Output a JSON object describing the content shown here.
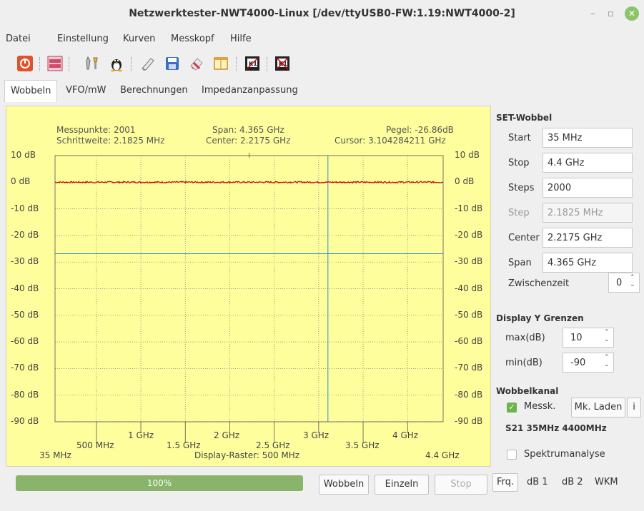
{
  "window": {
    "title": "Netzwerktester-NWT4000-Linux [/dev/ttyUSB0-FW:1.19:NWT4000-2]"
  },
  "menu": [
    "Datei",
    "Einstellung",
    "Kurven",
    "Messkopf",
    "Hilfe"
  ],
  "toolbar": [
    "power-icon",
    "png-bmp-icon",
    "tools-icon",
    "linux-icon",
    "open-icon",
    "save-icon",
    "eraser-icon",
    "window-icon",
    "k1-icon",
    "k1x-icon"
  ],
  "tabs": [
    "Wobbeln",
    "VFO/mW",
    "Berechnungen",
    "Impedanzanpassung"
  ],
  "plot": {
    "messpunkte": "Messpunkte: 2001",
    "schrittweite": "Schrittweite: 2.1825 MHz",
    "span": "Span: 4.365 GHz",
    "center": "Center: 2.2175 GHz",
    "pegel": "Pegel: -26.86dB",
    "cursor": "Cursor: 3.104284211 GHz",
    "raster": "Display-Raster: 500 MHz",
    "y_labels": [
      "10 dB",
      "0 dB",
      "-10 dB",
      "-20 dB",
      "-30 dB",
      "-40 dB",
      "-50 dB",
      "-60 dB",
      "-70 dB",
      "-80 dB",
      "-90 dB"
    ],
    "x_upper": [
      "1 GHz",
      "2 GHz",
      "3 GHz",
      "4 GHz"
    ],
    "x_lower": [
      "500 MHz",
      "1.5 GHz",
      "2.5 GHz",
      "3.5 GHz"
    ],
    "x_start": "35 MHz",
    "x_end": "4.4 GHz"
  },
  "chart_data": {
    "type": "line",
    "x_range_ghz": [
      0.035,
      4.4
    ],
    "ylim": [
      -90,
      10
    ],
    "grid": true,
    "series": [
      {
        "values_db_approx": 0
      }
    ],
    "cursor_ghz": 3.104284211,
    "marker_level_db": -26.86,
    "colors": {
      "trace": "#cc0000",
      "cursor": "#2a8ec8",
      "background": "#fefe9c"
    }
  },
  "set_wobbel": {
    "title": "SET-Wobbel",
    "start_label": "Start",
    "start_value": "35 MHz",
    "stop_label": "Stop",
    "stop_value": "4.4 GHz",
    "steps_label": "Steps",
    "steps_value": "2000",
    "step_label": "Step",
    "step_value": "2.1825 MHz",
    "center_label": "Center",
    "center_value": "2.2175 GHz",
    "span_label": "Span",
    "span_value": "4.365 GHz",
    "zwischenzeit_label": "Zwischenzeit",
    "zwischenzeit_value": "0"
  },
  "display_y": {
    "title": "Display Y Grenzen",
    "max_label": "max(dB)",
    "max_value": "10",
    "min_label": "min(dB)",
    "min_value": "-90"
  },
  "wobbelkanal": {
    "title": "Wobbelkanal",
    "messk_label": "Messk.",
    "mk_laden": "Mk. Laden",
    "info": "i",
    "s21": "S21 35MHz 4400MHz",
    "spektrum_label": "Spektrumanalyse"
  },
  "bottom": {
    "progress": "100%",
    "progress_value": 1.0,
    "wobbeln": "Wobbeln",
    "einzeln": "Einzeln",
    "stop": "Stop",
    "frq": "Frq.",
    "db1": "dB 1",
    "db2": "dB 2",
    "wkm": "WKM"
  }
}
